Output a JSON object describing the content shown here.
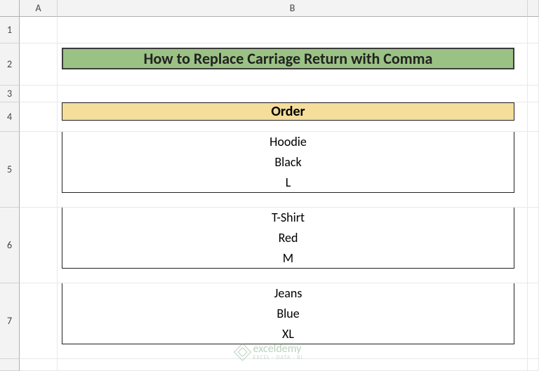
{
  "columns": {
    "A": "A",
    "B": "B"
  },
  "rows": {
    "r1": "1",
    "r2": "2",
    "r3": "3",
    "r4": "4",
    "r5": "5",
    "r6": "6",
    "r7": "7"
  },
  "title": "How to Replace Carriage Return with Comma",
  "table": {
    "header": "Order",
    "rows": [
      {
        "line1": "Hoodie",
        "line2": "Black",
        "line3": "L"
      },
      {
        "line1": "T-Shirt",
        "line2": "Red",
        "line3": "M"
      },
      {
        "line1": "Jeans",
        "line2": "Blue",
        "line3": "XL"
      }
    ]
  },
  "watermark": {
    "brand": "exceldemy",
    "sub": "EXCEL · DATA · BI"
  }
}
